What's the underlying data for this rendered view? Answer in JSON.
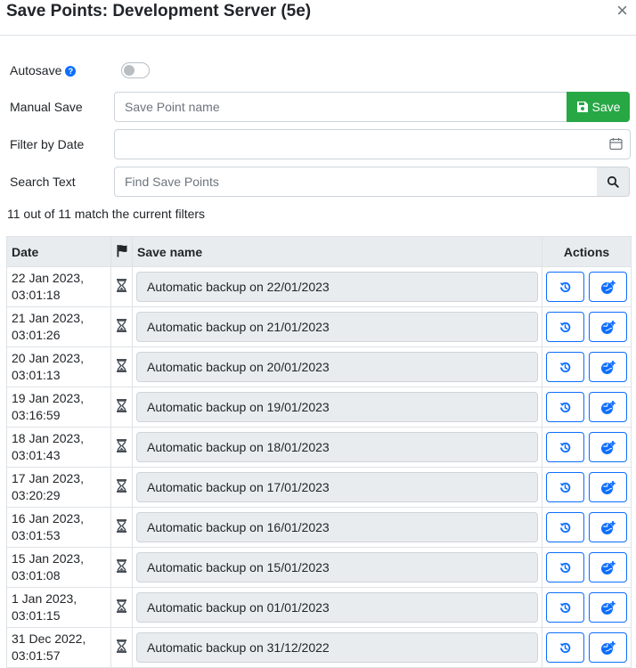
{
  "modal": {
    "title": "Save Points: Development Server (5e)",
    "close_label": "×"
  },
  "form": {
    "autosave_label": "Autosave",
    "autosave_help": "?",
    "autosave_on": false,
    "manual_save_label": "Manual Save",
    "manual_save_placeholder": "Save Point name",
    "save_button_label": "Save",
    "filter_date_label": "Filter by Date",
    "filter_date_value": "",
    "search_label": "Search Text",
    "search_placeholder": "Find Save Points"
  },
  "status": {
    "match_text": "11 out of 11 match the current filters"
  },
  "table": {
    "headers": {
      "date": "Date",
      "flag_icon": "flag-icon",
      "name": "Save name",
      "actions": "Actions"
    },
    "rows": [
      {
        "date_line1": "22 Jan 2023,",
        "date_line2": "03:01:18",
        "name": "Automatic backup on 22/01/2023"
      },
      {
        "date_line1": "21 Jan 2023,",
        "date_line2": "03:01:26",
        "name": "Automatic backup on 21/01/2023"
      },
      {
        "date_line1": "20 Jan 2023,",
        "date_line2": "03:01:13",
        "name": "Automatic backup on 20/01/2023"
      },
      {
        "date_line1": "19 Jan 2023,",
        "date_line2": "03:16:59",
        "name": "Automatic backup on 19/01/2023"
      },
      {
        "date_line1": "18 Jan 2023,",
        "date_line2": "03:01:43",
        "name": "Automatic backup on 18/01/2023"
      },
      {
        "date_line1": "17 Jan 2023,",
        "date_line2": "03:20:29",
        "name": "Automatic backup on 17/01/2023"
      },
      {
        "date_line1": "16 Jan 2023,",
        "date_line2": "03:01:53",
        "name": "Automatic backup on 16/01/2023"
      },
      {
        "date_line1": "15 Jan 2023,",
        "date_line2": "03:01:08",
        "name": "Automatic backup on 15/01/2023"
      },
      {
        "date_line1": "1 Jan 2023,",
        "date_line2": "03:01:15",
        "name": "Automatic backup on 01/01/2023"
      },
      {
        "date_line1": "31 Dec 2022,",
        "date_line2": "03:01:57",
        "name": "Automatic backup on 31/12/2022"
      }
    ]
  },
  "colors": {
    "accent": "#0d6efd",
    "save_green": "#28a745",
    "header_bg": "#e9ecef",
    "border": "#dee2e6"
  },
  "icons": {
    "row_type": "hourglass-icon",
    "restore": "restore-icon",
    "promote": "globe-plus-icon",
    "save": "floppy-disk-icon",
    "calendar": "calendar-icon",
    "search": "search-icon"
  }
}
